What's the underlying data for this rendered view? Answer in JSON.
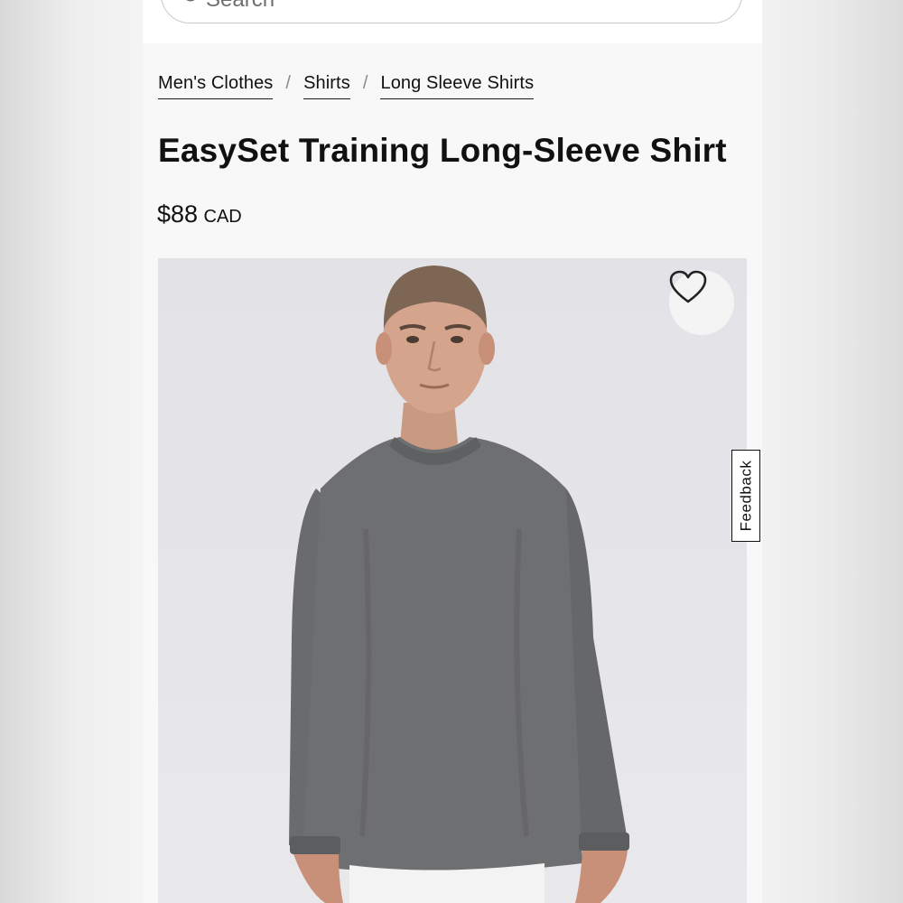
{
  "search": {
    "placeholder": "Search"
  },
  "breadcrumb": [
    {
      "label": "Men's Clothes"
    },
    {
      "label": "Shirts"
    },
    {
      "label": "Long Sleeve Shirts"
    }
  ],
  "breadcrumb_separator": "/",
  "product": {
    "title": "EasySet Training Long-Sleeve Shirt",
    "price": "$88",
    "currency": "CAD",
    "shirt_color": "#6e6f71"
  },
  "icons": {
    "wishlist": "heart-icon",
    "search": "search-icon"
  },
  "feedback": {
    "label": "Feedback"
  }
}
